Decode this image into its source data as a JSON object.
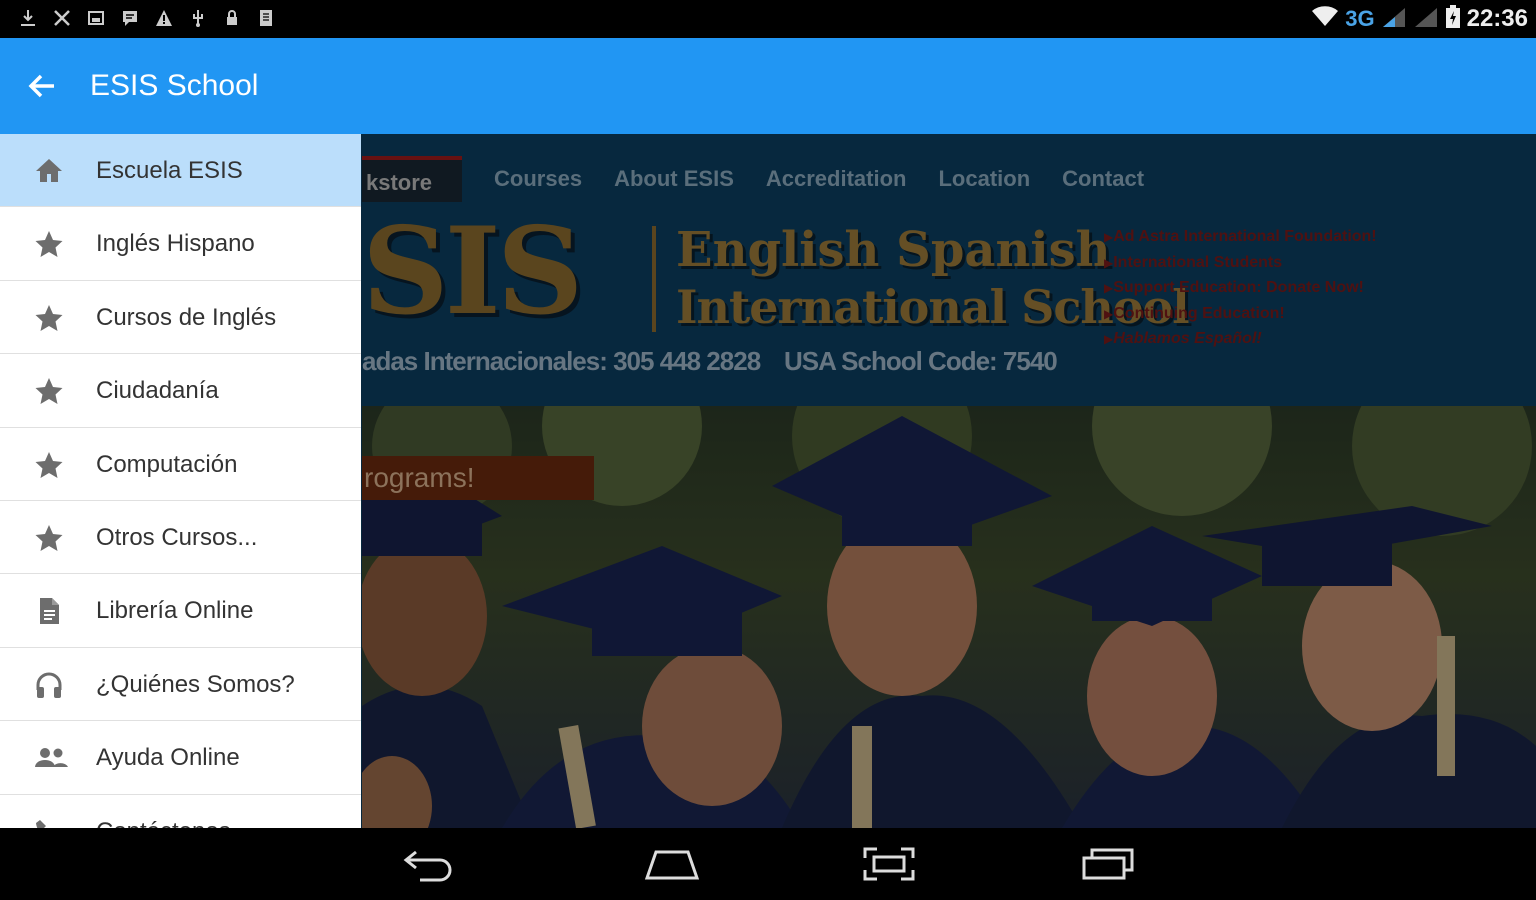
{
  "status_bar": {
    "left_icons": [
      "download-icon",
      "tools-icon",
      "image-icon",
      "message-icon",
      "warning-icon",
      "usb-icon",
      "lock-icon",
      "document-icon"
    ],
    "network": "3G",
    "time": "22:36"
  },
  "app_bar": {
    "title": "ESIS School",
    "back_icon": "arrow-back-icon",
    "color": "#2196F3"
  },
  "drawer": {
    "selected_color": "#BBDEFB",
    "items": [
      {
        "icon": "home-icon",
        "label": "Escuela ESIS",
        "selected": true
      },
      {
        "icon": "star-icon",
        "label": "Inglés Hispano"
      },
      {
        "icon": "star-icon",
        "label": "Cursos de Inglés"
      },
      {
        "icon": "star-icon",
        "label": "Ciudadanía"
      },
      {
        "icon": "star-icon",
        "label": "Computación"
      },
      {
        "icon": "star-icon",
        "label": "Otros Cursos..."
      },
      {
        "icon": "file-icon",
        "label": "Librería Online"
      },
      {
        "icon": "headset-icon",
        "label": "¿Quiénes Somos?"
      },
      {
        "icon": "people-icon",
        "label": "Ayuda Online"
      },
      {
        "icon": "phone-icon",
        "label": "Contáctenos"
      }
    ]
  },
  "website": {
    "nav": {
      "active": "kstore",
      "tabs": [
        "Courses",
        "About ESIS",
        "Accreditation",
        "Location",
        "Contact"
      ]
    },
    "logo": {
      "big": "SIS",
      "line1": "English Spanish",
      "line2": "International School"
    },
    "phone": "adas Internacionales: 305 448 2828",
    "school_code": "USA School Code: 7540",
    "links": [
      "Ad Astra International Foundation!",
      "International Students",
      "Support Education: Donate Now!",
      "Continuing Education!",
      "Hablamos Español!"
    ],
    "promo": "rograms!"
  },
  "nav_bar": {
    "buttons": [
      "back-button",
      "home-button",
      "screenshot-button",
      "recents-button"
    ]
  }
}
